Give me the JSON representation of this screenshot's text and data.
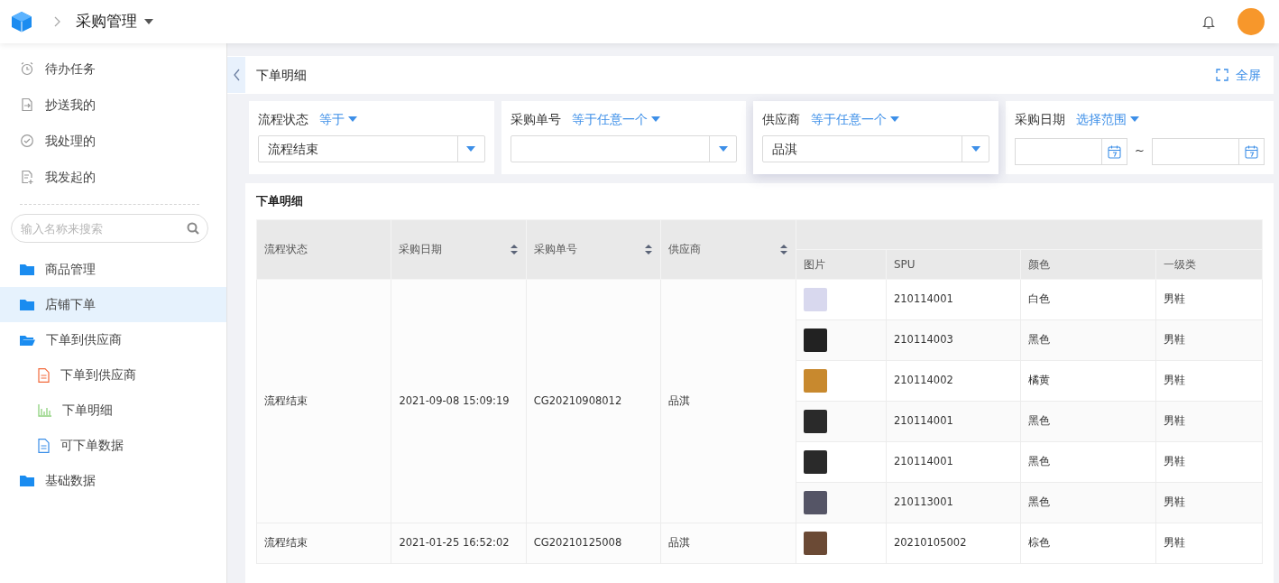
{
  "topbar": {
    "app_title": "采购管理"
  },
  "sidebar": {
    "quick_links": [
      {
        "label": "待办任务",
        "kind": "clock"
      },
      {
        "label": "抄送我的",
        "kind": "forward"
      },
      {
        "label": "我处理的",
        "kind": "check"
      },
      {
        "label": "我发起的",
        "kind": "add"
      }
    ],
    "search": {
      "placeholder": "输入名称来搜索"
    },
    "tree": [
      {
        "label": "商品管理",
        "kind": "folder",
        "expanded": false,
        "selected": false
      },
      {
        "label": "店铺下单",
        "kind": "folder",
        "expanded": false,
        "selected": true
      },
      {
        "label": "下单到供应商",
        "kind": "folder",
        "expanded": true,
        "selected": false,
        "children": [
          {
            "label": "下单到供应商",
            "kind": "form",
            "selected": false
          },
          {
            "label": "下单明细",
            "kind": "chart",
            "selected": false
          },
          {
            "label": "可下单数据",
            "kind": "doc",
            "selected": false
          }
        ]
      },
      {
        "label": "基础数据",
        "kind": "folder",
        "expanded": false,
        "selected": false
      }
    ]
  },
  "page": {
    "title": "下单明细",
    "fullscreen": "全屏"
  },
  "filters": [
    {
      "label": "流程状态",
      "operator": "等于",
      "kind": "select",
      "value": "流程结束",
      "focused": false
    },
    {
      "label": "采购单号",
      "operator": "等于任意一个",
      "kind": "select",
      "focused": false
    },
    {
      "label": "供应商",
      "operator": "等于任意一个",
      "kind": "select",
      "value": "品淇",
      "focused": true
    },
    {
      "label": "采购日期",
      "operator": "选择范围",
      "kind": "date-range",
      "separator": "~",
      "focused": false
    }
  ],
  "table": {
    "title": "下单明细",
    "columns": [
      {
        "label": "流程状态",
        "sortable": false
      },
      {
        "label": "采购日期",
        "sortable": true
      },
      {
        "label": "采购单号",
        "sortable": true
      },
      {
        "label": "供应商",
        "sortable": true
      }
    ],
    "group_columns": [
      {
        "label": "图片"
      },
      {
        "label": "SPU"
      },
      {
        "label": "颜色"
      },
      {
        "label": "一级类"
      }
    ],
    "rows": [
      {
        "status": "流程结束",
        "date": "2021-09-08 15:09:19",
        "order": "CG20210908012",
        "supplier": "品淇",
        "items": [
          {
            "spu": "210114001",
            "color_label": "白色",
            "category": "男鞋"
          },
          {
            "spu": "210114003",
            "color_label": "黑色",
            "category": "男鞋"
          },
          {
            "spu": "210114002",
            "color_label": "橘黄",
            "category": "男鞋"
          },
          {
            "spu": "210114001",
            "color_label": "黑色",
            "category": "男鞋"
          },
          {
            "spu": "210114001",
            "color_label": "黑色",
            "category": "男鞋"
          },
          {
            "spu": "210113001",
            "color_label": "黑色",
            "category": "男鞋"
          }
        ]
      },
      {
        "status": "流程结束",
        "date": "2021-01-25 16:52:02",
        "order": "CG20210125008",
        "supplier": "品淇",
        "items": [
          {
            "spu": "20210105002",
            "color_label": "棕色",
            "category": "男鞋"
          }
        ]
      }
    ]
  }
}
